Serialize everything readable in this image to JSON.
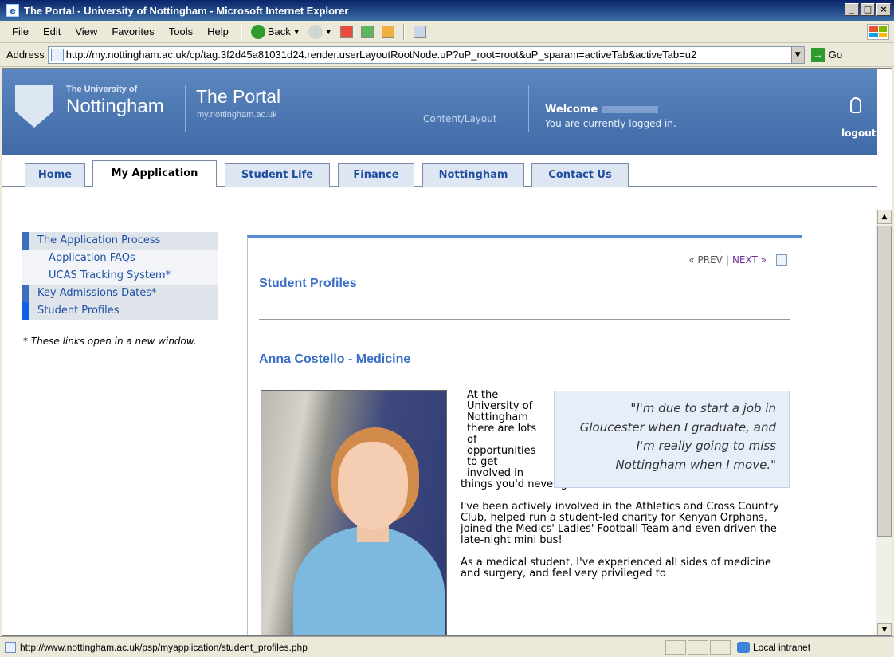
{
  "window": {
    "title": "The Portal - University of Nottingham - Microsoft Internet Explorer",
    "minimize": "_",
    "maximize": "□",
    "close": "×"
  },
  "menu": [
    "File",
    "Edit",
    "View",
    "Favorites",
    "Tools",
    "Help"
  ],
  "toolbar": {
    "back_label": "Back"
  },
  "address": {
    "label": "Address",
    "url": "http://my.nottingham.ac.uk/cp/tag.3f2d45a81031d24.render.userLayoutRootNode.uP?uP_root=root&uP_sparam=activeTab&activeTab=u2",
    "go_label": "Go"
  },
  "header": {
    "university_small": "The University of",
    "university_big": "Nottingham",
    "portal_title": "The Portal",
    "portal_sub": "my.nottingham.ac.uk",
    "content_layout": "Content/Layout",
    "welcome": "Welcome",
    "logged_in": "You are currently logged in.",
    "logout": "logout"
  },
  "tabs": [
    {
      "label": "Home"
    },
    {
      "label": "My Application"
    },
    {
      "label": "Student Life"
    },
    {
      "label": "Finance"
    },
    {
      "label": "Nottingham"
    },
    {
      "label": "Contact Us"
    }
  ],
  "sidebar": {
    "items": [
      {
        "label": "The Application Process"
      },
      {
        "label": "Application FAQs"
      },
      {
        "label": "UCAS Tracking System*"
      },
      {
        "label": "Key Admissions Dates*"
      },
      {
        "label": "Student Profiles"
      }
    ],
    "note": "* These links open in a new window."
  },
  "content": {
    "prev": "« PREV",
    "pager_sep": "|",
    "next": "NEXT »",
    "section_title": "Student Profiles",
    "profile_name": "Anna Costello - Medicine",
    "quote": "\"I'm due to start a job in Gloucester when I graduate, and I'm really going to miss Nottingham when I move.\"",
    "para1_start": "At the University of Nottingham there are lots of opportunities to get involved in",
    "para1_end": "things you'd never get the chance to elsewhere.",
    "para2": "I've been actively involved in the Athletics and Cross Country Club, helped run a student-led charity for Kenyan Orphans, joined the Medics' Ladies' Football Team and even driven the late-night mini bus!",
    "para3": "As a medical student, I've experienced all sides of medicine and surgery, and feel very privileged to"
  },
  "status": {
    "url": "http://www.nottingham.ac.uk/psp/myapplication/student_profiles.php",
    "zone": "Local intranet"
  }
}
